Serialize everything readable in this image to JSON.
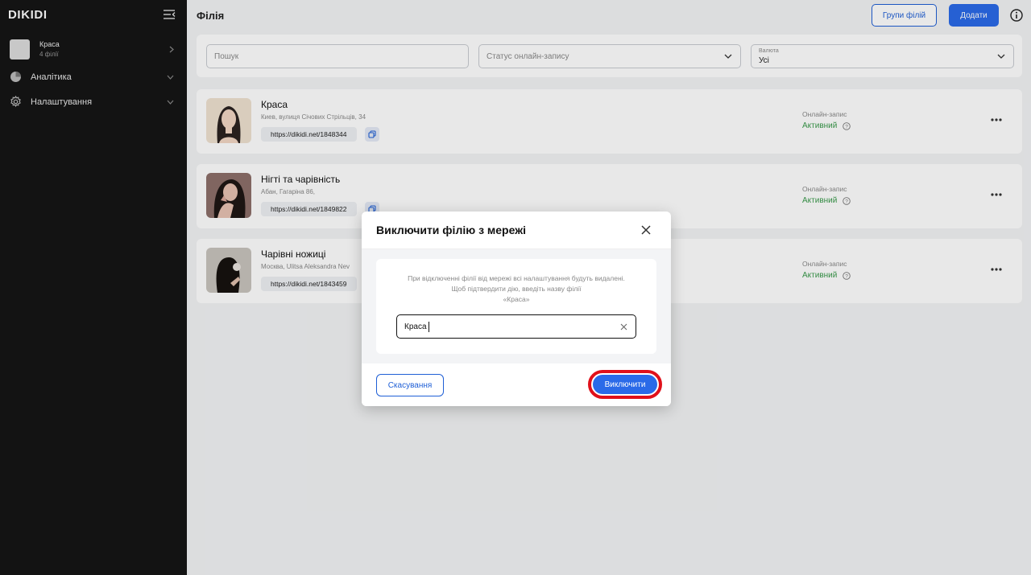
{
  "sidebar": {
    "logo": "DIKIDI",
    "account": {
      "name": "Краса",
      "sub": "4 філії"
    },
    "items": [
      {
        "label": "Аналітика",
        "icon": "pie-chart-icon"
      },
      {
        "label": "Налаштування",
        "icon": "gear-icon"
      }
    ]
  },
  "header": {
    "title": "Філія",
    "groups_label": "Групи філій",
    "add_label": "Додати"
  },
  "filters": {
    "search_placeholder": "Пошук",
    "status_placeholder": "Статус онлайн-запису",
    "currency_label": "Валюта",
    "currency_value": "Усі"
  },
  "branches": [
    {
      "title": "Краса",
      "address": "Киев, вулиця Січових Стрільців, 34",
      "link": "https://dikidi.net/1848344",
      "online_label": "Онлайн-запис",
      "online_value": "Активний"
    },
    {
      "title": "Нігті та чарівність",
      "address": "Абан, Гагаріна 86,",
      "link": "https://dikidi.net/1849822",
      "online_label": "Онлайн-запис",
      "online_value": "Активний"
    },
    {
      "title": "Чарівні ножиці",
      "address": "Москва, Ulitsa Aleksandra Nev",
      "link": "https://dikidi.net/1843459",
      "online_label": "Онлайн-запис",
      "online_value": "Активний"
    }
  ],
  "modal": {
    "title": "Виключити філію з мережі",
    "message_line1": "При відключенні філії від мережі всі налаштування будуть видалені.",
    "message_line2": "Щоб підтвердити дію, введіть назву філії",
    "message_line3": "«Краса»",
    "input_value": "Краса",
    "cancel_label": "Скасування",
    "confirm_label": "Виключити"
  },
  "colors": {
    "accent": "#2a6ae8",
    "active_status": "#3a9a4b",
    "highlight_ring": "#e0101a",
    "sidebar_bg": "#151515"
  }
}
